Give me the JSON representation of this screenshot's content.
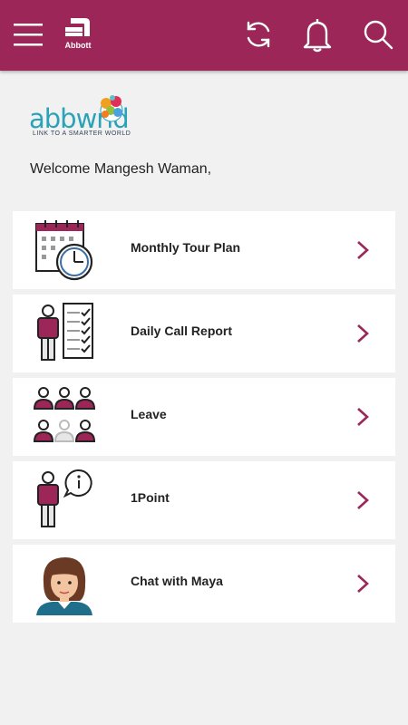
{
  "header": {
    "logo_text": "Abbott",
    "colors": {
      "brand": "#9c2658",
      "accent_teal": "#2aa3b8"
    }
  },
  "brand": {
    "name": "abbwrld",
    "tagline": "LINK TO A SMARTER WORLD"
  },
  "welcome": "Welcome Mangesh Waman,",
  "menu": [
    {
      "label": "Monthly Tour Plan",
      "icon": "calendar-clock-icon"
    },
    {
      "label": "Daily Call Report",
      "icon": "report-checklist-icon"
    },
    {
      "label": "Leave",
      "icon": "team-icon"
    },
    {
      "label": "1Point",
      "icon": "person-info-icon"
    },
    {
      "label": "Chat with Maya",
      "icon": "maya-avatar-icon"
    }
  ]
}
